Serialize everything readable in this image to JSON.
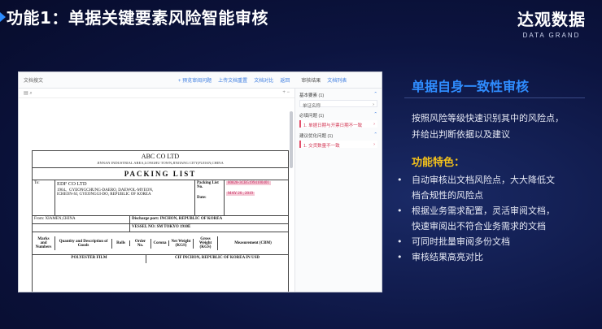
{
  "slide": {
    "title": "功能1：单据关键要素风险智能审核",
    "brand_name": "达观数据",
    "brand_sub": "DATA GRAND"
  },
  "screenshot": {
    "doc_title": "文档搜文",
    "tools": [
      "+ 预览审阅问题",
      "上传文档重置",
      "文档对比",
      "返回"
    ],
    "review_header": "审核结果",
    "review_filter": "文档列表",
    "groups": [
      {
        "label": "基本要素 (1)",
        "item": "单证名称"
      },
      {
        "label": "必填问题 (1)",
        "item": "1. 单据日期与开票日期不一致"
      },
      {
        "label": "建议优化问题 (1)",
        "item": "1. 交货数量不一致"
      }
    ],
    "packing": {
      "company": "ABC CO LTD",
      "address": "JINNAN INDUSTRIAL AREA,LONGHU TOWN,JINJIANG CITY,FUJIAN,CHINA",
      "title": "PACKING   LIST",
      "to_label": "To:",
      "to_company": "EDF CO LTD",
      "to_addr1": "1964、GYEONGCHUNG-DAERO, DAEWOL-MYEON,",
      "to_addr2": "ICHEON-SI, GYEONGGI-DO, REPUBLIC OF KOREA",
      "list_no_label": "Packing List No.",
      "list_no": "80828-3CB51994100401",
      "date_label": "Date:",
      "date": "MAY 26 , 2019",
      "from": "From: XIAMEN,CHINA",
      "discharge": "Discharge port: INCHON, REPUBLIC OF KOREA",
      "vessel": "VESSEL NO: SM TOKYO 1910E",
      "columns": [
        "Marks and Numbers",
        "Quantity and Description of Goods",
        "Rolls",
        "Order No.",
        "Corona",
        "Net Weight (KGS)",
        "Gross Weight (KGS)",
        "Measurement (CBM)"
      ],
      "goods": "POLYESTER FILM",
      "terms": "CIF INCHON, REPUBLIC OF KOREA IN USD"
    }
  },
  "info": {
    "title": "单据自身一致性审核",
    "desc_line1": "按照风险等级快速识别其中的风险点，",
    "desc_line2": "并给出判断依据以及建议",
    "feature_title": "功能特色：",
    "features": [
      "自动审核出文档风险点，大大降低文",
      "档合规性的风险点",
      "根据业务需求配置，灵活审阅文档，",
      "快速审阅出不符合业务需求的文档",
      "可同时批量审阅多份文档",
      "审核结果高亮对比"
    ]
  },
  "colors": {
    "accent": "#2f8dff",
    "feature": "#f4c21b",
    "risk": "#e3506b"
  }
}
